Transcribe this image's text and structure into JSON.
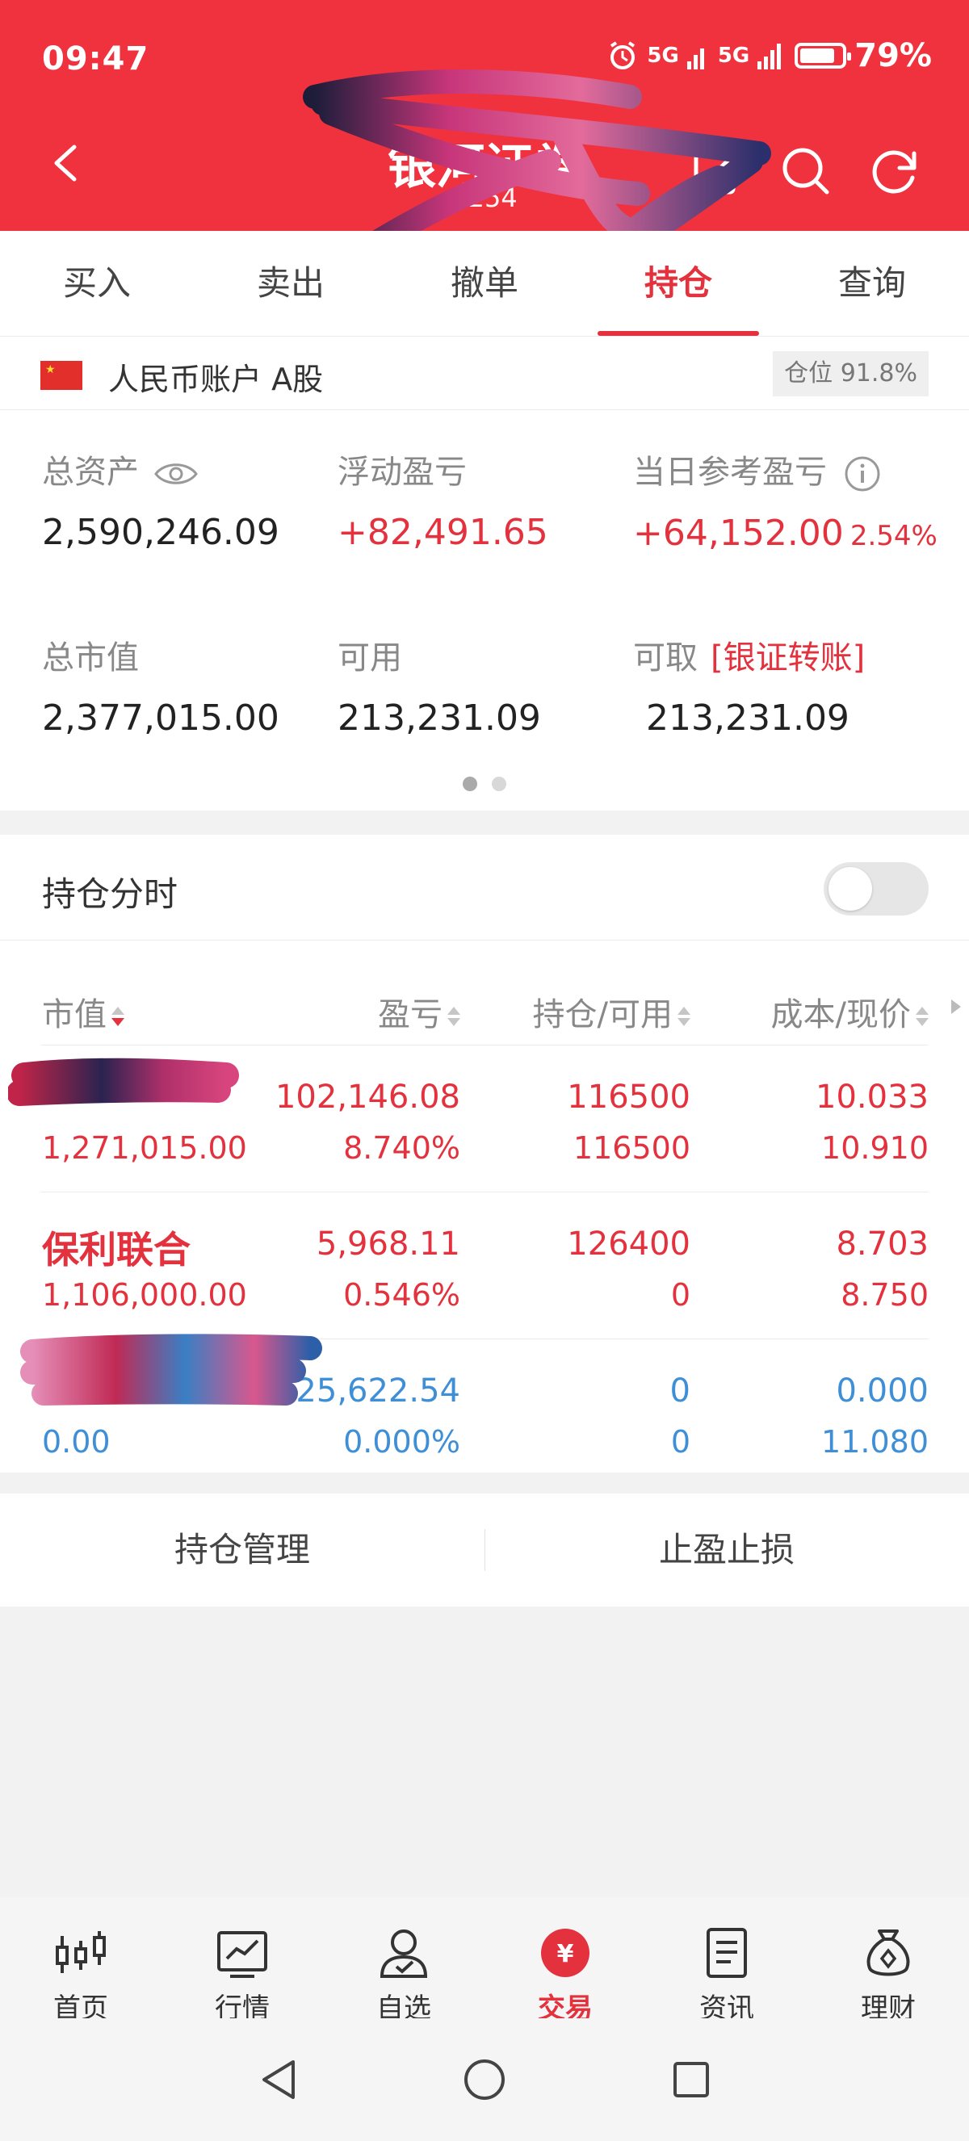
{
  "status": {
    "time": "09:47",
    "signal1": "5G",
    "signal2": "5G",
    "battery": "79%",
    "battery_level": 0.79
  },
  "header": {
    "title": "银河证券",
    "subtitle": "7254"
  },
  "tabs": [
    {
      "label": "买入"
    },
    {
      "label": "卖出"
    },
    {
      "label": "撤单"
    },
    {
      "label": "持仓",
      "active": true
    },
    {
      "label": "查询"
    }
  ],
  "account": {
    "name": "人民币账户 A股",
    "position_ratio": "仓位 91.8%"
  },
  "assets": {
    "total_assets": {
      "label": "总资产",
      "value": "2,590,246.09"
    },
    "floating_pl": {
      "label": "浮动盈亏",
      "value": "+82,491.65"
    },
    "daily_pl": {
      "label": "当日参考盈亏",
      "value": "+64,152.00",
      "pct": "2.54%"
    },
    "market_value": {
      "label": "总市值",
      "value": "2,377,015.00"
    },
    "available": {
      "label": "可用",
      "value": "213,231.09"
    },
    "withdrawable": {
      "label": "可取",
      "link": "[银证转账]",
      "value": "213,231.09"
    }
  },
  "holdings": {
    "title": "持仓分时",
    "toggle_on": false,
    "columns": [
      "市值",
      "盈亏",
      "持仓/可用",
      "成本/现价"
    ],
    "rows": [
      {
        "name": "",
        "market_value": "1,271,015.00",
        "pl": "102,146.08",
        "pl_pct": "8.740%",
        "position": "116500",
        "available": "116500",
        "cost": "10.033",
        "price": "10.910",
        "tone": "red"
      },
      {
        "name": "保利联合",
        "market_value": "1,106,000.00",
        "pl": "5,968.11",
        "pl_pct": "0.546%",
        "position": "126400",
        "available": "0",
        "cost": "8.703",
        "price": "8.750",
        "tone": "red"
      },
      {
        "name": "",
        "market_value": "0.00",
        "pl": "-25,622.54",
        "pl_pct": "0.000%",
        "position": "0",
        "available": "0",
        "cost": "0.000",
        "price": "11.080",
        "tone": "blue"
      }
    ]
  },
  "actions": {
    "manage": "持仓管理",
    "stop": "止盈止损"
  },
  "bottom_nav": [
    {
      "label": "首页",
      "icon": "candlestick-icon"
    },
    {
      "label": "行情",
      "icon": "line-chart-icon"
    },
    {
      "label": "自选",
      "icon": "person-check-icon"
    },
    {
      "label": "交易",
      "icon": "yuan-coin-icon",
      "active": true
    },
    {
      "label": "资讯",
      "icon": "document-icon"
    },
    {
      "label": "理财",
      "icon": "money-bag-icon"
    }
  ],
  "colors": {
    "brand_red": "#f0323f",
    "gain_red": "#e3313d",
    "loss_blue": "#3f8fd6"
  }
}
